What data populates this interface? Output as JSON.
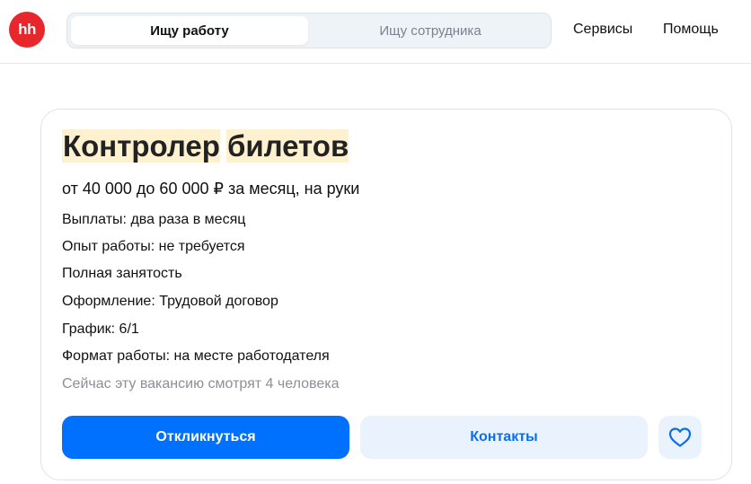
{
  "header": {
    "logo_text": "hh",
    "tabs": [
      {
        "label": "Ищу работу",
        "active": true
      },
      {
        "label": "Ищу сотрудника",
        "active": false
      }
    ],
    "nav": {
      "services": "Сервисы",
      "help": "Помощь"
    }
  },
  "vacancy": {
    "title_words": [
      "Контролер",
      "билетов"
    ],
    "salary": "от 40 000 до 60 000 ₽ за месяц, на руки",
    "details": [
      "Выплаты: два раза в месяц",
      "Опыт работы: не требуется",
      "Полная занятость",
      "Оформление: Трудовой договор",
      "График: 6/1",
      "Формат работы: на месте работодателя"
    ],
    "viewers": "Сейчас эту вакансию смотрят 4 человека",
    "actions": {
      "apply": "Откликнуться",
      "contacts": "Контакты"
    }
  },
  "colors": {
    "brand": "#e8272c",
    "primary": "#0070ff",
    "secondary_bg": "#eaf3fd",
    "highlight": "#fdf1cf"
  },
  "icons": {
    "favorite": "heart-icon"
  }
}
